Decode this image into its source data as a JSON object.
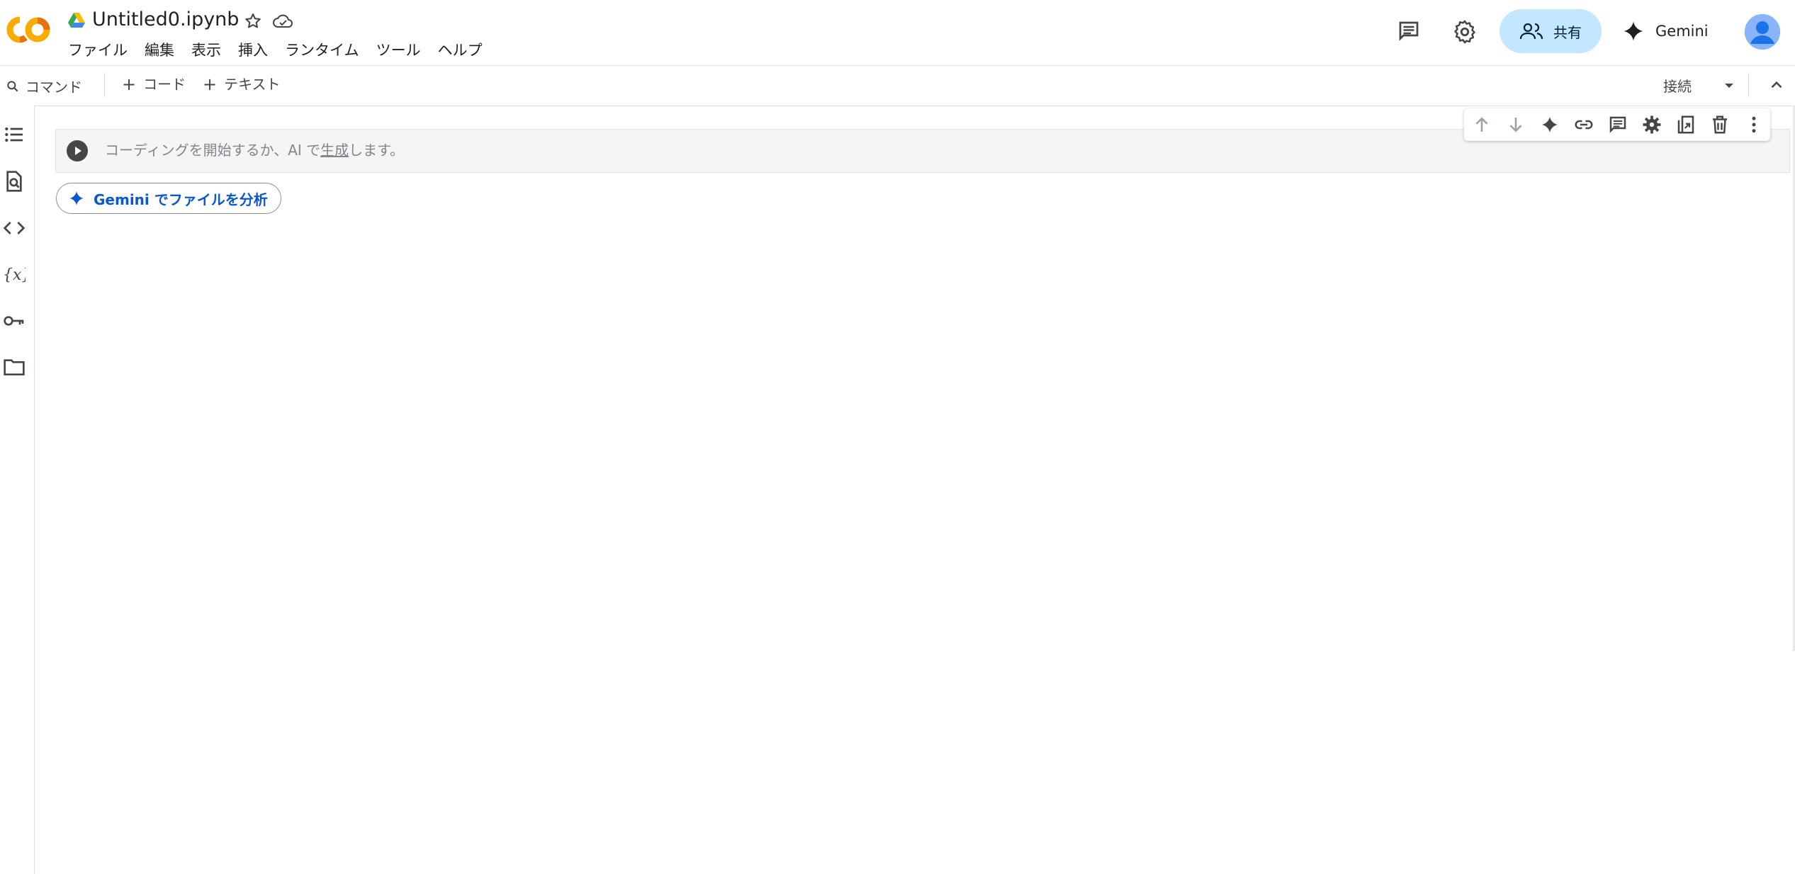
{
  "header": {
    "logo_text": "CO",
    "title": "Untitled0.ipynb",
    "menu": [
      "ファイル",
      "編集",
      "表示",
      "挿入",
      "ランタイム",
      "ツール",
      "ヘルプ"
    ],
    "share_label": "共有",
    "gemini_label": "Gemini"
  },
  "toolbar": {
    "command_label": "コマンド",
    "add_code_label": "コード",
    "add_text_label": "テキスト",
    "plus_glyph": "+",
    "connect_label": "接続"
  },
  "cell": {
    "hint_prefix": "コーディングを開始するか、AI で",
    "hint_link": "生成",
    "hint_suffix": "します。"
  },
  "analyze_chip": {
    "label": "Gemini でファイルを分析"
  },
  "colors": {
    "share_bg": "#c2e7ff",
    "gemini_blue": "#0b57d0",
    "logo_orange": "#f9ab00",
    "logo_dark_orange": "#e8710a"
  },
  "icons": {
    "rail": [
      "toc-icon",
      "find-icon",
      "code-snippets-icon",
      "variables-icon",
      "secrets-key-icon",
      "folder-icon"
    ],
    "cell_toolbar": [
      "arrow-up-icon",
      "arrow-down-icon",
      "gemini-sparkle-icon",
      "link-icon",
      "comment-icon",
      "settings-icon",
      "mirror-cell-icon",
      "delete-icon",
      "more-vert-icon"
    ]
  }
}
